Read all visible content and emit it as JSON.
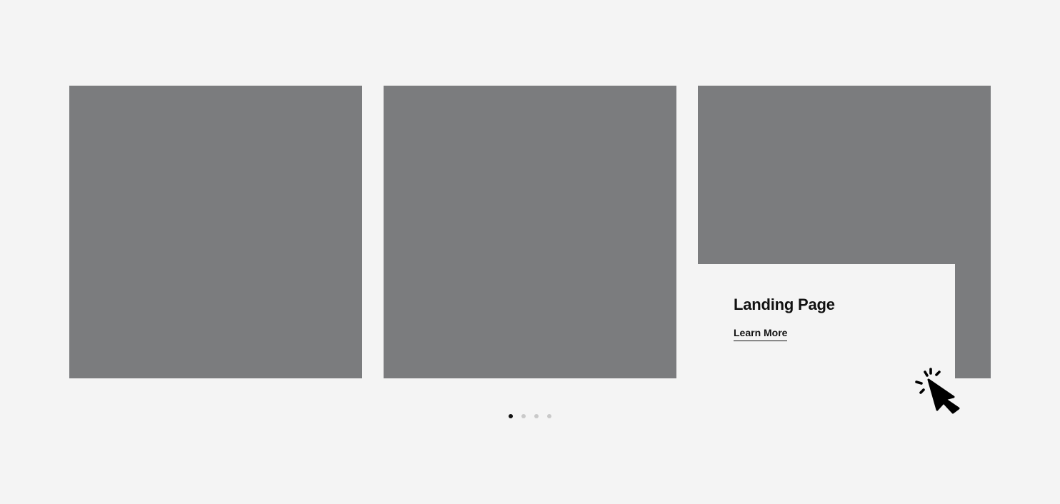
{
  "slides": [
    {
      "kind": "image-placeholder"
    },
    {
      "kind": "image-placeholder"
    },
    {
      "kind": "image-placeholder",
      "caption": {
        "title": "Landing Page",
        "link_label": "Learn More"
      }
    }
  ],
  "pagination": {
    "total": 4,
    "active_index": 0
  },
  "colors": {
    "background": "#f4f4f4",
    "placeholder": "#7b7c7e",
    "text": "#111111",
    "dot_active": "#111111",
    "dot_inactive": "#c9c9c9"
  },
  "icons": {
    "cursor": "click-cursor-icon"
  }
}
